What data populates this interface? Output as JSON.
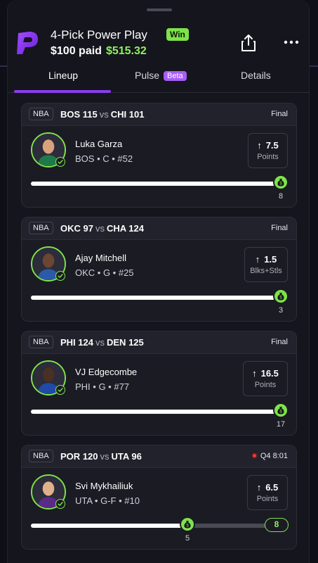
{
  "header": {
    "title": "4-Pick Power Play",
    "result_badge": "Win",
    "paid_label": "$100 paid",
    "payout": "$515.32"
  },
  "tabs": [
    {
      "label": "Lineup",
      "active": true
    },
    {
      "label": "Pulse",
      "badge": "Beta"
    },
    {
      "label": "Details"
    }
  ],
  "picks": [
    {
      "league": "NBA",
      "away_team": "BOS",
      "away_score": "115",
      "vs": "vs",
      "home_team": "CHI",
      "home_score": "101",
      "status": "Final",
      "player": "Luka Garza",
      "info": "BOS • C • #52",
      "line": "7.5",
      "stat": "Points",
      "actual": "8",
      "progress": 1.0
    },
    {
      "league": "NBA",
      "away_team": "OKC",
      "away_score": "97",
      "vs": "vs",
      "home_team": "CHA",
      "home_score": "124",
      "status": "Final",
      "player": "Ajay Mitchell",
      "info": "OKC • G • #25",
      "line": "1.5",
      "stat": "Blks+Stls",
      "actual": "3",
      "progress": 1.0
    },
    {
      "league": "NBA",
      "away_team": "PHI",
      "away_score": "124",
      "vs": "vs",
      "home_team": "DEN",
      "home_score": "125",
      "status": "Final",
      "player": "VJ Edgecombe",
      "info": "PHI • G • #77",
      "line": "16.5",
      "stat": "Points",
      "actual": "17",
      "progress": 1.0
    },
    {
      "league": "NBA",
      "away_team": "POR",
      "away_score": "120",
      "vs": "vs",
      "home_team": "UTA",
      "home_score": "96",
      "status": "Q4 8:01",
      "live": true,
      "player": "Svi Mykhailiuk",
      "info": "UTA • G-F • #10",
      "line": "6.5",
      "stat": "Points",
      "actual": "5",
      "target": "8",
      "progress": 0.625
    }
  ],
  "colors": {
    "accent": "#8b3cf0",
    "win": "#7ee34a",
    "live": "#ef3a3a"
  }
}
